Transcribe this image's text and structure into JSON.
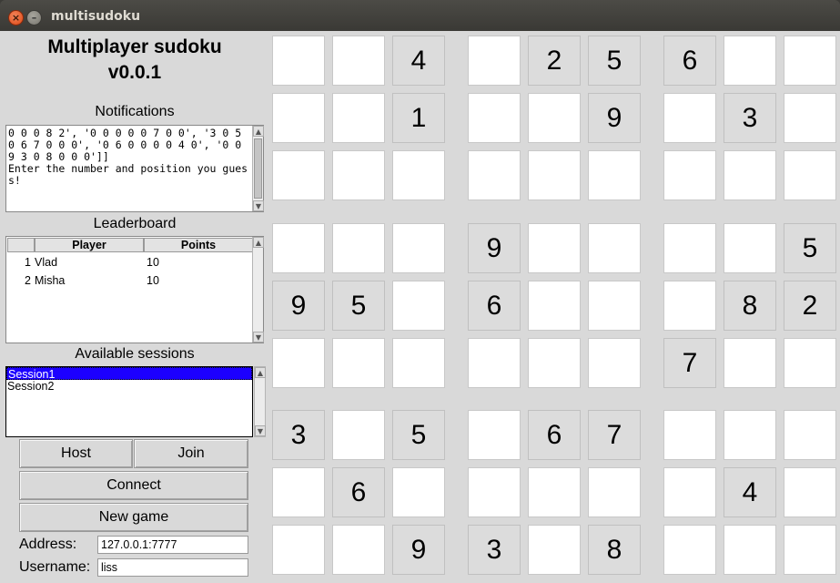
{
  "window": {
    "title": "multisudoku"
  },
  "app": {
    "title_line1": "Multiplayer sudoku",
    "title_line2": "v0.0.1"
  },
  "notifications": {
    "label": "Notifications",
    "text": "0 0 0 8 2', '0 0 0 0 0 7 0 0', '3 0 5 0 6 7 0 0 0', '0 6 0 0 0 0 4 0', '0 0 9 3 0 8 0 0 0']]\nEnter the number and position you guess!"
  },
  "leaderboard": {
    "label": "Leaderboard",
    "columns": [
      "",
      "Player",
      "Points"
    ],
    "rows": [
      {
        "index": "1",
        "player": "Vlad",
        "points": "10"
      },
      {
        "index": "2",
        "player": "Misha",
        "points": "10"
      }
    ]
  },
  "sessions": {
    "label": "Available sessions",
    "items": [
      {
        "name": "Session1",
        "selected": true
      },
      {
        "name": "Session2",
        "selected": false
      }
    ]
  },
  "buttons": {
    "host": "Host",
    "join": "Join",
    "connect": "Connect",
    "new_game": "New game"
  },
  "fields": {
    "address_label": "Address:",
    "address_value": "127.0.0.1:7777",
    "username_label": "Username:",
    "username_value": "liss"
  },
  "grid": [
    [
      "",
      "",
      "4",
      "",
      "2",
      "5",
      "6",
      "",
      ""
    ],
    [
      "",
      "",
      "1",
      "",
      "",
      "9",
      "",
      "3",
      ""
    ],
    [
      "",
      "",
      "",
      "",
      "",
      "",
      "",
      "",
      ""
    ],
    [
      "",
      "",
      "",
      "9",
      "",
      "",
      "",
      "",
      "5"
    ],
    [
      "9",
      "5",
      "",
      "6",
      "",
      "",
      "",
      "8",
      "2"
    ],
    [
      "",
      "",
      "",
      "",
      "",
      "",
      "7",
      "",
      ""
    ],
    [
      "3",
      "",
      "5",
      "",
      "6",
      "7",
      "",
      "",
      ""
    ],
    [
      "",
      "6",
      "",
      "",
      "",
      "",
      "",
      "4",
      ""
    ],
    [
      "",
      "",
      "9",
      "3",
      "",
      "8",
      "",
      "",
      ""
    ]
  ]
}
